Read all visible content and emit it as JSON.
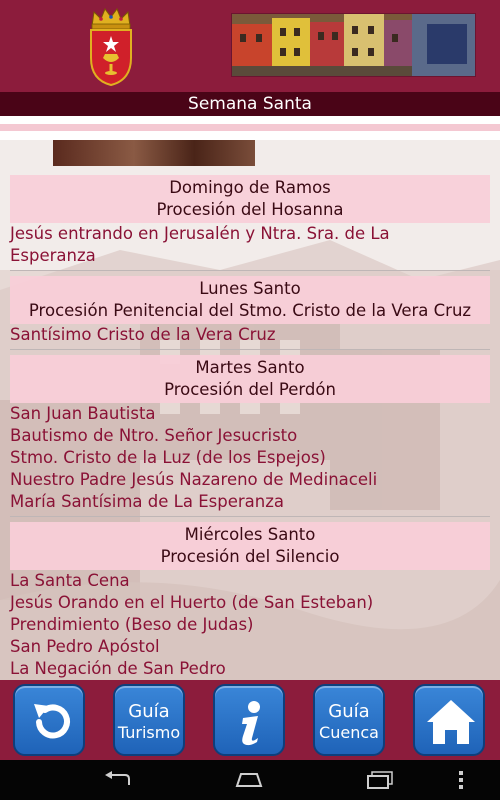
{
  "header": {
    "title": "Semana Santa"
  },
  "days": [
    {
      "day": "Domingo de Ramos",
      "procession": "Procesión del Hosanna",
      "items": [
        "Jesús entrando en Jerusalén y Ntra. Sra. de La",
        "Esperanza"
      ]
    },
    {
      "day": "Lunes Santo",
      "procession": "Procesión Penitencial del Stmo. Cristo de la Vera Cruz",
      "items": [
        "Santísimo Cristo de la Vera Cruz"
      ]
    },
    {
      "day": "Martes Santo",
      "procession": "Procesión del Perdón",
      "items": [
        "San Juan Bautista",
        "Bautismo de Ntro. Señor Jesucristo",
        "Stmo. Cristo de la Luz (de los Espejos)",
        "Nuestro Padre Jesús Nazareno de Medinaceli",
        "María Santísima de La Esperanza"
      ]
    },
    {
      "day": "Miércoles Santo",
      "procession": "Procesión del Silencio",
      "items": [
        "La Santa Cena",
        "Jesús Orando en el Huerto (de San Esteban)",
        "Prendimiento (Beso de Judas)",
        "San Pedro Apóstol",
        "La Negación de San Pedro"
      ]
    }
  ],
  "nav": {
    "back_icon": "back-arrow-icon",
    "turismo_line1": "Guía",
    "turismo_line2": "Turismo",
    "info_icon": "info-icon",
    "cuenca_line1": "Guía",
    "cuenca_line2": "Cuenca",
    "home_icon": "home-icon"
  },
  "system_bar": {
    "icons": [
      "back-icon",
      "home-icon",
      "recents-icon",
      "menu-icon"
    ]
  },
  "colors": {
    "brand": "#8c1c3c",
    "title_bar": "#4a0417",
    "day_header_bg": "#f8ced8",
    "item_text": "#8a1236",
    "button_blue": "#2a75cc"
  }
}
